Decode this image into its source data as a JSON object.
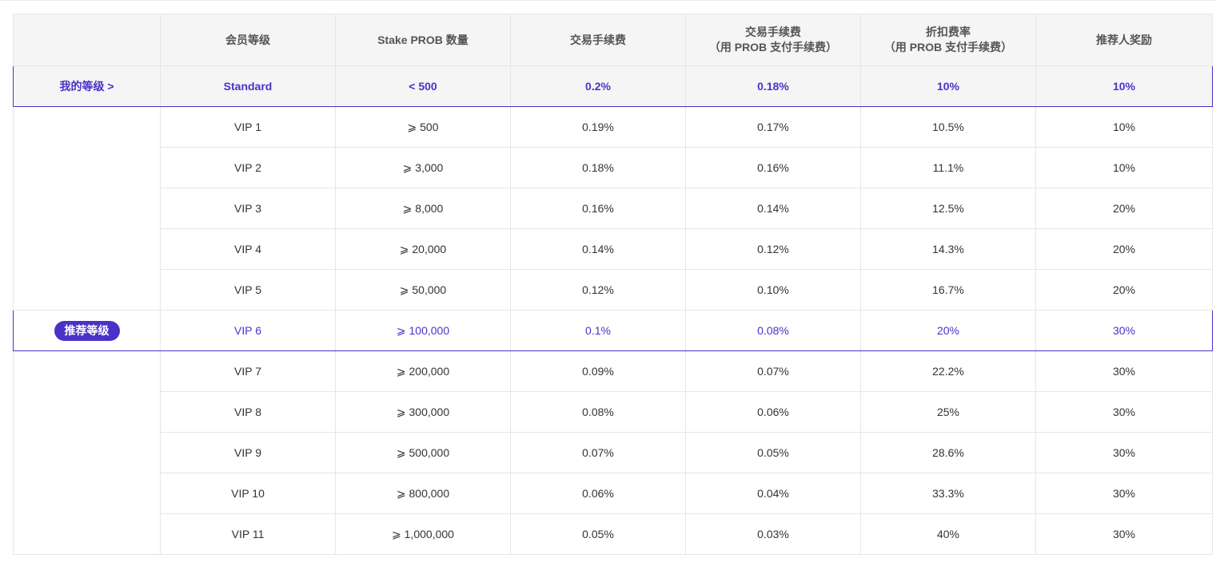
{
  "table": {
    "headers": [
      {
        "line1": "",
        "line2": ""
      },
      {
        "line1": "会员等级",
        "line2": ""
      },
      {
        "line1": "Stake PROB 数量",
        "line2": ""
      },
      {
        "line1": "交易手续费",
        "line2": ""
      },
      {
        "line1": "交易手续费",
        "line2": "（用 PROB 支付手续费）"
      },
      {
        "line1": "折扣费率",
        "line2": "（用 PROB 支付手续费）"
      },
      {
        "line1": "推荐人奖励",
        "line2": ""
      }
    ],
    "current_label": "我的等级 >",
    "recommended_label": "推荐等级",
    "rows": [
      {
        "level": "Standard",
        "stake": "< 500",
        "fee": "0.2%",
        "fee_prob": "0.18%",
        "discount": "10%",
        "referral": "10%"
      },
      {
        "level": "VIP 1",
        "stake": "⩾ 500",
        "fee": "0.19%",
        "fee_prob": "0.17%",
        "discount": "10.5%",
        "referral": "10%"
      },
      {
        "level": "VIP 2",
        "stake": "⩾ 3,000",
        "fee": "0.18%",
        "fee_prob": "0.16%",
        "discount": "11.1%",
        "referral": "10%"
      },
      {
        "level": "VIP 3",
        "stake": "⩾ 8,000",
        "fee": "0.16%",
        "fee_prob": "0.14%",
        "discount": "12.5%",
        "referral": "20%"
      },
      {
        "level": "VIP 4",
        "stake": "⩾ 20,000",
        "fee": "0.14%",
        "fee_prob": "0.12%",
        "discount": "14.3%",
        "referral": "20%"
      },
      {
        "level": "VIP 5",
        "stake": "⩾ 50,000",
        "fee": "0.12%",
        "fee_prob": "0.10%",
        "discount": "16.7%",
        "referral": "20%"
      },
      {
        "level": "VIP 6",
        "stake": "⩾ 100,000",
        "fee": "0.1%",
        "fee_prob": "0.08%",
        "discount": "20%",
        "referral": "30%"
      },
      {
        "level": "VIP 7",
        "stake": "⩾ 200,000",
        "fee": "0.09%",
        "fee_prob": "0.07%",
        "discount": "22.2%",
        "referral": "30%"
      },
      {
        "level": "VIP 8",
        "stake": "⩾ 300,000",
        "fee": "0.08%",
        "fee_prob": "0.06%",
        "discount": "25%",
        "referral": "30%"
      },
      {
        "level": "VIP 9",
        "stake": "⩾ 500,000",
        "fee": "0.07%",
        "fee_prob": "0.05%",
        "discount": "28.6%",
        "referral": "30%"
      },
      {
        "level": "VIP 10",
        "stake": "⩾ 800,000",
        "fee": "0.06%",
        "fee_prob": "0.04%",
        "discount": "33.3%",
        "referral": "30%"
      },
      {
        "level": "VIP 11",
        "stake": "⩾ 1,000,000",
        "fee": "0.05%",
        "fee_prob": "0.03%",
        "discount": "40%",
        "referral": "30%"
      }
    ]
  },
  "colors": {
    "accent": "#4a32c8",
    "header_bg": "#f5f5f5",
    "border": "#e6e6e6"
  }
}
